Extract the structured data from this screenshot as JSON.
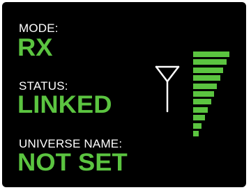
{
  "mode": {
    "label": "MODE:",
    "value": "RX"
  },
  "status": {
    "label": "STATUS:",
    "value": "LINKED"
  },
  "universe": {
    "label": "UNIVERSE NAME:",
    "value": "NOT SET"
  },
  "signal": {
    "icon": "antenna-icon",
    "level": 1.0,
    "bar_count": 11
  },
  "colors": {
    "background": "#000000",
    "label": "#ffffff",
    "value": "#5bc440",
    "signal": "#5bc440",
    "antenna": "#ffffff"
  }
}
